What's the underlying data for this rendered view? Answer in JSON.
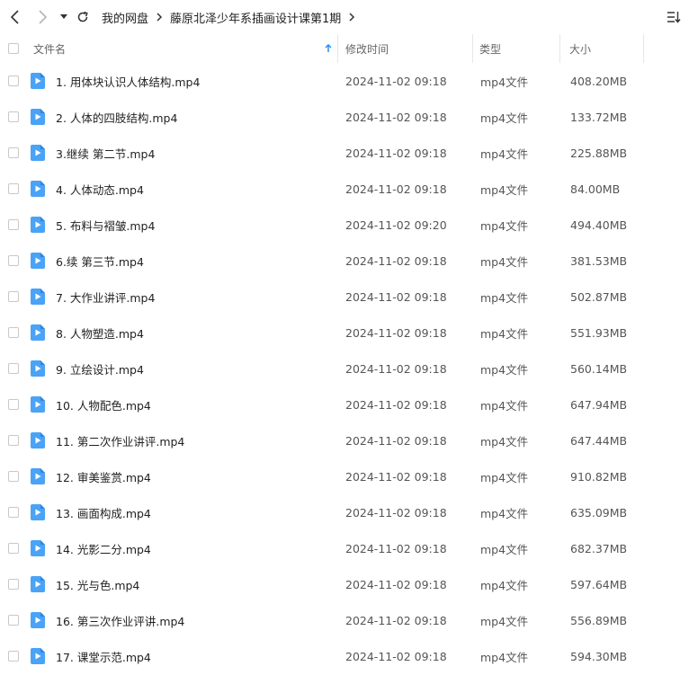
{
  "toolbar": {
    "breadcrumb": [
      "我的网盘",
      "藤原北泽少年系插画设计课第1期"
    ]
  },
  "columns": {
    "name": "文件名",
    "modified": "修改时间",
    "type": "类型",
    "size": "大小"
  },
  "colors": {
    "accent": "#2b8ff5",
    "icon": "#4aa3f7"
  },
  "files": [
    {
      "name": "1. 用体块认识人体结构.mp4",
      "modified": "2024-11-02 09:18",
      "type": "mp4文件",
      "size": "408.20MB"
    },
    {
      "name": "2. 人体的四肢结构.mp4",
      "modified": "2024-11-02 09:18",
      "type": "mp4文件",
      "size": "133.72MB"
    },
    {
      "name": "3.继续 第二节.mp4",
      "modified": "2024-11-02 09:18",
      "type": "mp4文件",
      "size": "225.88MB"
    },
    {
      "name": "4. 人体动态.mp4",
      "modified": "2024-11-02 09:18",
      "type": "mp4文件",
      "size": "84.00MB"
    },
    {
      "name": "5. 布料与褶皱.mp4",
      "modified": "2024-11-02 09:20",
      "type": "mp4文件",
      "size": "494.40MB"
    },
    {
      "name": "6.续 第三节.mp4",
      "modified": "2024-11-02 09:18",
      "type": "mp4文件",
      "size": "381.53MB"
    },
    {
      "name": "7. 大作业讲评.mp4",
      "modified": "2024-11-02 09:18",
      "type": "mp4文件",
      "size": "502.87MB"
    },
    {
      "name": "8. 人物塑造.mp4",
      "modified": "2024-11-02 09:18",
      "type": "mp4文件",
      "size": "551.93MB"
    },
    {
      "name": "9. 立绘设计.mp4",
      "modified": "2024-11-02 09:18",
      "type": "mp4文件",
      "size": "560.14MB"
    },
    {
      "name": "10. 人物配色.mp4",
      "modified": "2024-11-02 09:18",
      "type": "mp4文件",
      "size": "647.94MB"
    },
    {
      "name": "11. 第二次作业讲评.mp4",
      "modified": "2024-11-02 09:18",
      "type": "mp4文件",
      "size": "647.44MB"
    },
    {
      "name": "12. 审美鉴赏.mp4",
      "modified": "2024-11-02 09:18",
      "type": "mp4文件",
      "size": "910.82MB"
    },
    {
      "name": "13. 画面构成.mp4",
      "modified": "2024-11-02 09:18",
      "type": "mp4文件",
      "size": "635.09MB"
    },
    {
      "name": "14. 光影二分.mp4",
      "modified": "2024-11-02 09:18",
      "type": "mp4文件",
      "size": "682.37MB"
    },
    {
      "name": "15. 光与色.mp4",
      "modified": "2024-11-02 09:18",
      "type": "mp4文件",
      "size": "597.64MB"
    },
    {
      "name": "16. 第三次作业评讲.mp4",
      "modified": "2024-11-02 09:18",
      "type": "mp4文件",
      "size": "556.89MB"
    },
    {
      "name": "17. 课堂示范.mp4",
      "modified": "2024-11-02 09:18",
      "type": "mp4文件",
      "size": "594.30MB"
    }
  ]
}
